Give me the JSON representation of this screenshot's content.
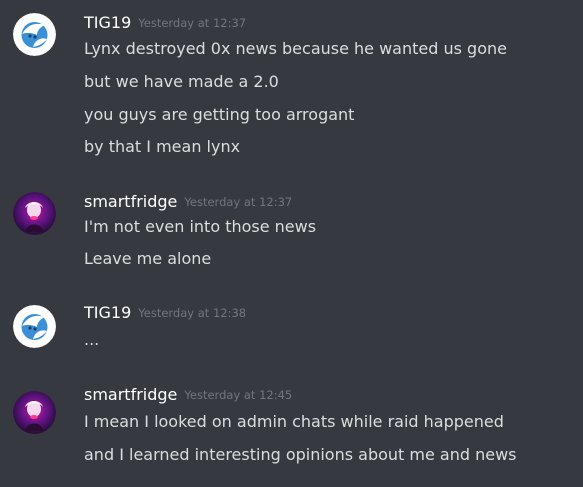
{
  "messages": [
    {
      "author": "TIG19",
      "timestamp": "Yesterday at 12:37",
      "avatar_icon": "tig19-avatar",
      "lines": [
        "Lynx destroyed 0x news because he wanted us gone",
        "but we have made a 2.0",
        "you guys are getting too arrogant",
        "by that I mean lynx"
      ]
    },
    {
      "author": "smartfridge",
      "timestamp": "Yesterday at 12:37",
      "avatar_icon": "smartfridge-avatar",
      "lines": [
        "I'm not even into those news",
        "Leave me alone"
      ]
    },
    {
      "author": "TIG19",
      "timestamp": "Yesterday at 12:38",
      "avatar_icon": "tig19-avatar",
      "lines": [
        "..."
      ]
    },
    {
      "author": "smartfridge",
      "timestamp": "Yesterday at 12:45",
      "avatar_icon": "smartfridge-avatar",
      "lines": [
        "I mean I looked on admin chats while raid happened",
        "and I learned interesting opinions about me and news"
      ]
    }
  ],
  "colors": {
    "background": "#36393f",
    "username": "#ffffff",
    "timestamp": "#72767d",
    "message_text": "#dcddde"
  }
}
